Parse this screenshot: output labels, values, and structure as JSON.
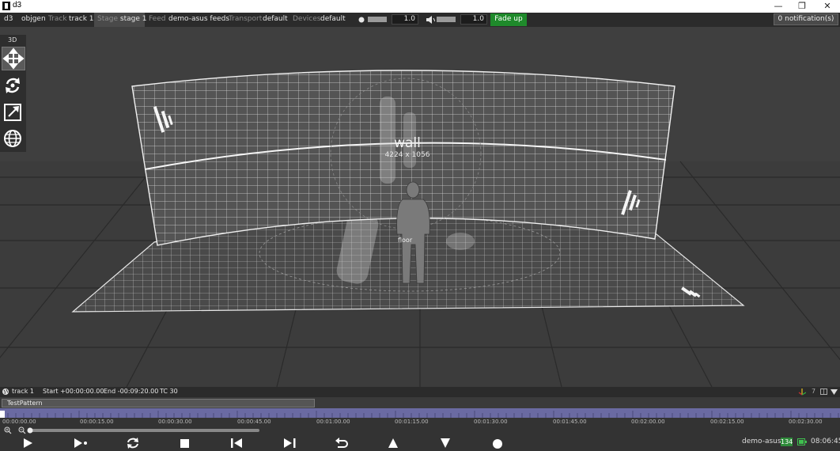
{
  "window": {
    "title": "d3",
    "minimize_glyph": "—",
    "restore_glyph": "❐",
    "close_glyph": "✕"
  },
  "topbar": {
    "app": "d3",
    "project": "objgen",
    "track_label": "Track",
    "track_value": "track 1",
    "stage_label": "Stage",
    "stage_value": "stage 1",
    "feed_label": "Feed",
    "feed_value": "demo-asus feeds",
    "transport_label": "Transport",
    "transport_value": "default",
    "devices_label": "Devices",
    "devices_value": "default",
    "brightness_value": "1.0",
    "volume_value": "1.0",
    "fade_button": "Fade up",
    "notifications": "0 notification(s)"
  },
  "toolbox": {
    "mode_label": "3D",
    "tools": [
      {
        "name": "move-tool",
        "icon": "move-arrows-icon",
        "active": true
      },
      {
        "name": "rotate-tool",
        "icon": "rotate-icon",
        "active": false
      },
      {
        "name": "scale-tool",
        "icon": "scale-icon",
        "active": false
      },
      {
        "name": "globe-tool",
        "icon": "globe-icon",
        "active": false
      }
    ]
  },
  "scene": {
    "wall_name": "wall",
    "wall_subname": "wall",
    "wall_resolution": "4224 x 1056",
    "floor_name": "floor"
  },
  "trackbar": {
    "track": "track 1",
    "start": "Start +00:00:00.00",
    "end": "End -00:09:20.00",
    "tc": "TC 30",
    "counter": "7"
  },
  "layer": {
    "name": "TestPattern"
  },
  "timecodes": [
    "00:00:00.00",
    "00:00:15.00",
    "00:00:30.00",
    "00:00:45.00",
    "00:01:00.00",
    "00:01:15.00",
    "00:01:30.00",
    "00:01:45.00",
    "00:02:00.00",
    "00:02:15.00",
    "00:02:30.00"
  ],
  "transport": {
    "machine": "demo-asus",
    "fps": "134",
    "clock": "08:06:45"
  },
  "colors": {
    "fade_green": "#1f8a2b",
    "timeline_purple": "#6a6aa2",
    "fps_green": "#2e8b3a"
  }
}
